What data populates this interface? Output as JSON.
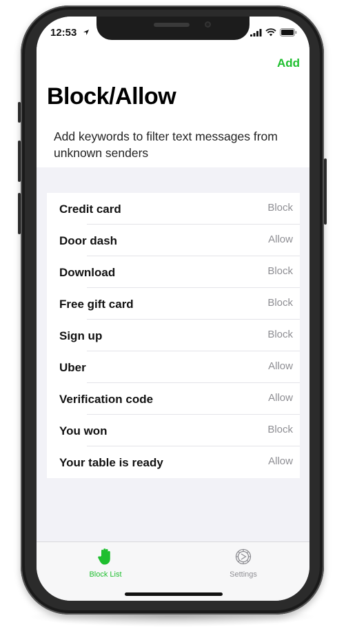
{
  "status_bar": {
    "time": "12:53"
  },
  "nav": {
    "add_label": "Add"
  },
  "page": {
    "title": "Block/Allow",
    "subtitle": "Add keywords to filter text messages from unknown senders"
  },
  "keywords": [
    {
      "label": "Credit card",
      "value": "Block"
    },
    {
      "label": "Door dash",
      "value": "Allow"
    },
    {
      "label": "Download",
      "value": "Block"
    },
    {
      "label": "Free gift card",
      "value": "Block"
    },
    {
      "label": "Sign up",
      "value": "Block"
    },
    {
      "label": "Uber",
      "value": "Allow"
    },
    {
      "label": "Verification code",
      "value": "Allow"
    },
    {
      "label": "You won",
      "value": "Block"
    },
    {
      "label": "Your table is ready",
      "value": "Allow"
    }
  ],
  "tabbar": {
    "block_list_label": "Block List",
    "settings_label": "Settings"
  },
  "colors": {
    "accent": "#1fbf2f",
    "secondary_text": "#8e8e93",
    "grouped_background": "#f2f2f7"
  }
}
